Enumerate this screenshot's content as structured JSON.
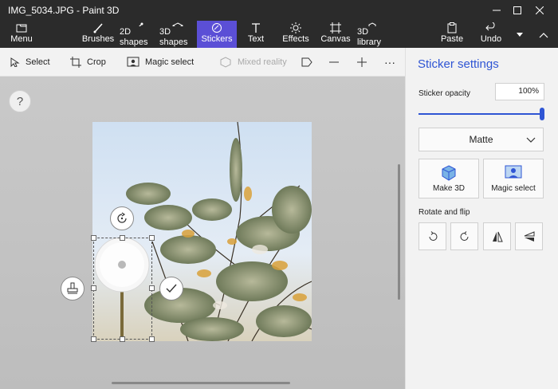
{
  "window": {
    "title": "IMG_5034.JPG - Paint 3D",
    "minimize": "—",
    "maximize": "☐",
    "close": "✕"
  },
  "ribbon": {
    "menu": "Menu",
    "tabs": [
      "Brushes",
      "2D shapes",
      "3D shapes",
      "Stickers",
      "Text",
      "Effects",
      "Canvas",
      "3D library"
    ],
    "active_tab": "Stickers",
    "paste": "Paste",
    "undo": "Undo"
  },
  "toolbar": {
    "select": "Select",
    "crop": "Crop",
    "magic_select": "Magic select",
    "mixed_reality": "Mixed reality",
    "more": "···"
  },
  "canvas": {
    "help": "?"
  },
  "panel": {
    "title": "Sticker settings",
    "opacity_label": "Sticker opacity",
    "opacity_value": "100%",
    "opacity_fraction": 1.0,
    "finish_selected": "Matte",
    "make3d": "Make 3D",
    "magic_select": "Magic select",
    "rotate_flip_label": "Rotate and flip"
  },
  "colors": {
    "accent": "#5b4fd6",
    "panel_accent": "#2f55d4"
  }
}
